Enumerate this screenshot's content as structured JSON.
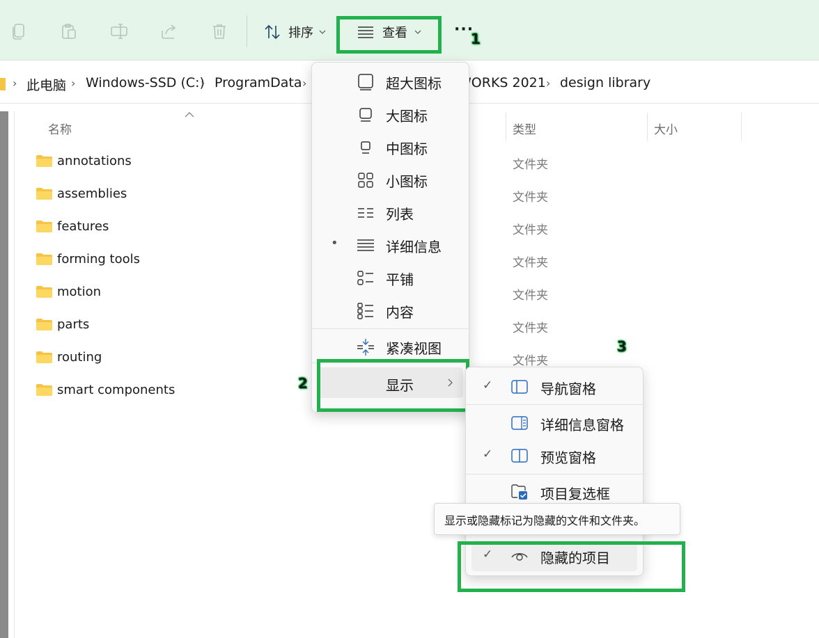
{
  "toolbar": {
    "copy_icon": "copy-icon",
    "paste_icon": "paste-icon",
    "rename_icon": "rename-icon",
    "share_icon": "share-icon",
    "delete_icon": "delete-icon",
    "sort_label": "排序",
    "view_label": "查看",
    "more_label": "···"
  },
  "annotations": {
    "a1": "1",
    "a2": "2",
    "a3": "3"
  },
  "breadcrumb": [
    "此电脑",
    "Windows-SSD (C:)",
    "ProgramData",
    "WORKS 2021",
    "design library"
  ],
  "columns": {
    "name": "名称",
    "type": "类型",
    "size": "大小"
  },
  "rows": [
    {
      "name": "annotations",
      "type": "文件夹"
    },
    {
      "name": "assemblies",
      "type": "文件夹"
    },
    {
      "name": "features",
      "type": "文件夹"
    },
    {
      "name": "forming tools",
      "type": "文件夹"
    },
    {
      "name": "motion",
      "type": "文件夹"
    },
    {
      "name": "parts",
      "type": "文件夹"
    },
    {
      "name": "routing",
      "type": "文件夹"
    },
    {
      "name": "smart components",
      "type": ""
    }
  ],
  "view_menu": {
    "items": [
      "超大图标",
      "大图标",
      "中图标",
      "小图标",
      "列表",
      "详细信息",
      "平铺",
      "内容"
    ],
    "selected_bullet": "•",
    "compact": "紧凑视图",
    "show": "显示"
  },
  "show_menu": {
    "nav_pane": "导航窗格",
    "details_pane": "详细信息窗格",
    "preview_pane": "预览窗格",
    "item_checkboxes": "项目复选框",
    "hidden_items": "隐藏的项目",
    "check": "✓"
  },
  "tooltip": "显示或隐藏标记为隐藏的文件和文件夹。",
  "colors": {
    "accent": "#22b14c",
    "toolbar_bg": "#e6f5ea",
    "folder": "#f6c444"
  }
}
